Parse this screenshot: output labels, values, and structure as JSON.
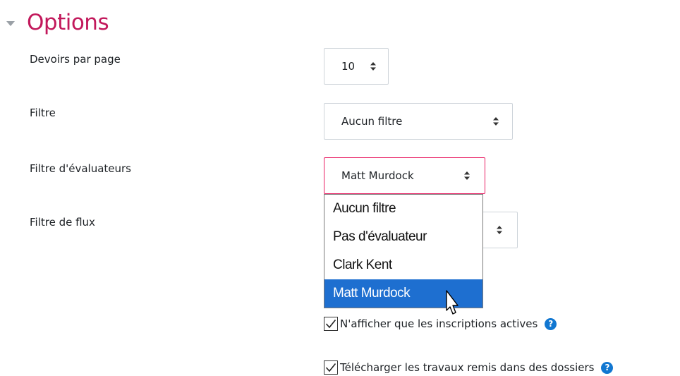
{
  "section": {
    "title": "Options"
  },
  "fields": {
    "per_page": {
      "label": "Devoirs par page",
      "value": "10"
    },
    "filter": {
      "label": "Filtre",
      "value": "Aucun filtre"
    },
    "marker_filter": {
      "label": "Filtre d'évaluateurs",
      "value": "Matt Murdock"
    },
    "workflow_filter": {
      "label": "Filtre de flux",
      "value": ""
    }
  },
  "dropdown": {
    "options": [
      "Aucun filtre",
      "Pas d'évaluateur",
      "Clark Kent",
      "Matt Murdock"
    ],
    "selected": "Matt Murdock"
  },
  "checkboxes": {
    "active_only": {
      "label": "N'afficher que les inscriptions actives",
      "checked": true
    },
    "download_folders": {
      "label": "Télécharger les travaux remis dans des dossiers",
      "checked": true
    }
  },
  "colors": {
    "title": "#c2185b",
    "focus_border": "#e91e63",
    "selected_bg": "#1e6fd0",
    "help": "#1177d1"
  }
}
